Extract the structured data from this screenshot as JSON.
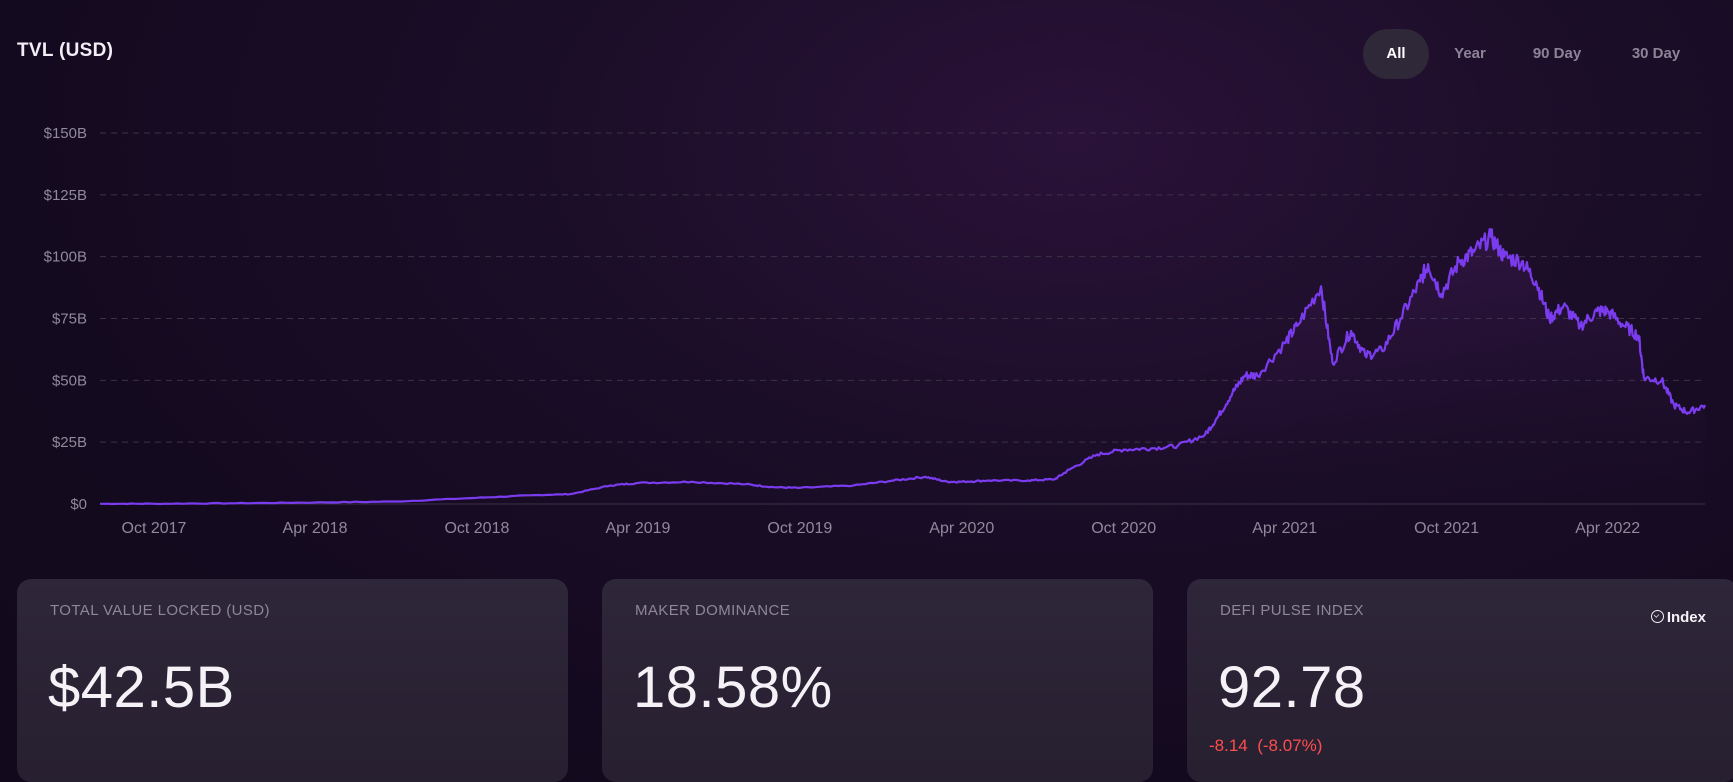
{
  "chart_title": "TVL (USD)",
  "range_tabs": [
    "All",
    "Year",
    "90 Day",
    "30 Day"
  ],
  "active_tab": "All",
  "cards": [
    {
      "label": "TOTAL VALUE LOCKED (USD)",
      "value": "$42.5B"
    },
    {
      "label": "MAKER DOMINANCE",
      "value": "18.58%"
    },
    {
      "label": "DEFI PULSE INDEX",
      "value": "92.78",
      "change": "-8.14  (-8.07%)",
      "link": "Index"
    }
  ],
  "colors": {
    "line": "#7b3cf0",
    "negative": "#ff4d4d",
    "grid": "#3a3347"
  },
  "chart_data": {
    "type": "area",
    "title": "TVL (USD)",
    "xlabel": "",
    "ylabel": "",
    "grid": true,
    "ylim": [
      0,
      150
    ],
    "xlim": [
      "2017-08-01",
      "2022-07-20"
    ],
    "x_ticks": [
      "Oct 2017",
      "Apr 2018",
      "Oct 2018",
      "Apr 2019",
      "Oct 2019",
      "Apr 2020",
      "Oct 2020",
      "Apr 2021",
      "Oct 2021",
      "Apr 2022"
    ],
    "x_tick_dates": [
      "2017-10-01",
      "2018-04-01",
      "2018-10-01",
      "2019-04-01",
      "2019-10-01",
      "2020-04-01",
      "2020-10-01",
      "2021-04-01",
      "2021-10-01",
      "2022-04-01"
    ],
    "y_ticks": [
      "$0",
      "$25B",
      "$50B",
      "$75B",
      "$100B",
      "$125B",
      "$150B"
    ],
    "y_tick_values": [
      0,
      25,
      50,
      75,
      100,
      125,
      150
    ],
    "series": [
      {
        "x": [
          "2017-08-01",
          "2017-10-01",
          "2018-01-01",
          "2018-04-01",
          "2018-07-01",
          "2018-10-01",
          "2018-12-01",
          "2019-01-15",
          "2019-03-01",
          "2019-04-01",
          "2019-06-01",
          "2019-08-01",
          "2019-09-01",
          "2019-10-01",
          "2019-12-01",
          "2020-01-15",
          "2020-02-20",
          "2020-03-15",
          "2020-04-01",
          "2020-05-01",
          "2020-06-15",
          "2020-07-15",
          "2020-08-01",
          "2020-09-01",
          "2020-10-01",
          "2020-11-01",
          "2020-12-01",
          "2021-01-01",
          "2021-01-15",
          "2021-02-01",
          "2021-02-15",
          "2021-03-01",
          "2021-04-01",
          "2021-04-15",
          "2021-05-12",
          "2021-05-25",
          "2021-06-15",
          "2021-07-01",
          "2021-07-20",
          "2021-08-10",
          "2021-09-01",
          "2021-09-10",
          "2021-09-25",
          "2021-10-15",
          "2021-11-01",
          "2021-11-20",
          "2021-12-05",
          "2021-12-25",
          "2022-01-10",
          "2022-01-25",
          "2022-02-10",
          "2022-03-01",
          "2022-03-20",
          "2022-04-01",
          "2022-04-20",
          "2022-05-06",
          "2022-05-12",
          "2022-06-01",
          "2022-06-15",
          "2022-07-01",
          "2022-07-20"
        ],
        "y": [
          0.1,
          0.1,
          0.3,
          0.6,
          1.0,
          2.5,
          3.5,
          4.0,
          7.5,
          8.5,
          9.0,
          8.0,
          6.8,
          6.5,
          7.5,
          9.5,
          11.0,
          9.0,
          9.0,
          9.5,
          9.5,
          10.0,
          14.0,
          20.0,
          22.0,
          22.5,
          23.5,
          28.0,
          35.0,
          45.0,
          52.0,
          52.0,
          65.0,
          72.0,
          88.0,
          57.0,
          70.0,
          60.0,
          62.0,
          75.0,
          90.0,
          97.0,
          85.0,
          98.0,
          102.0,
          108.0,
          100.0,
          98.0,
          90.0,
          75.0,
          80.0,
          72.0,
          78.0,
          78.0,
          72.0,
          68.0,
          51.0,
          50.0,
          40.0,
          37.0,
          40.0
        ]
      }
    ]
  }
}
